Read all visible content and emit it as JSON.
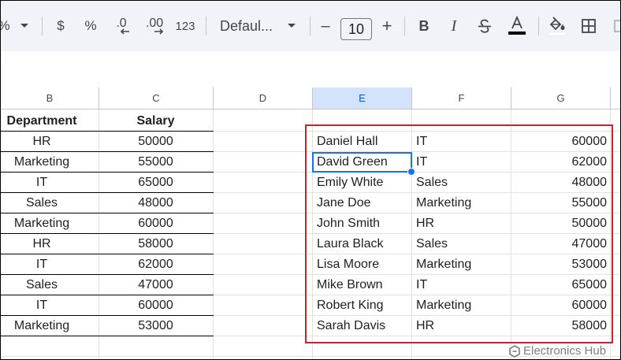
{
  "toolbar": {
    "percent_partial": "%",
    "currency": "$",
    "percent": "%",
    "decrease_decimal": ".0",
    "increase_decimal": ".00",
    "number_format": "123",
    "font_name": "Defaul...",
    "font_size": "10",
    "minus": "–",
    "plus": "+",
    "bold": "B",
    "italic": "I"
  },
  "columns": [
    {
      "id": "B",
      "label": "B"
    },
    {
      "id": "C",
      "label": "C"
    },
    {
      "id": "D",
      "label": "D"
    },
    {
      "id": "E",
      "label": "E"
    },
    {
      "id": "F",
      "label": "F"
    },
    {
      "id": "G",
      "label": "G"
    }
  ],
  "left_table": {
    "headers": {
      "department": "Department",
      "salary": "Salary"
    },
    "rows": [
      {
        "department": "HR",
        "salary": "50000"
      },
      {
        "department": "Marketing",
        "salary": "55000"
      },
      {
        "department": "IT",
        "salary": "65000"
      },
      {
        "department": "Sales",
        "salary": "48000"
      },
      {
        "department": "Marketing",
        "salary": "60000"
      },
      {
        "department": "HR",
        "salary": "58000"
      },
      {
        "department": "IT",
        "salary": "62000"
      },
      {
        "department": "Sales",
        "salary": "47000"
      },
      {
        "department": "IT",
        "salary": "60000"
      },
      {
        "department": "Marketing",
        "salary": "53000"
      }
    ]
  },
  "right_table": {
    "rows": [
      {
        "name": "Daniel Hall",
        "department": "IT",
        "salary": "60000"
      },
      {
        "name": "David Green",
        "department": "IT",
        "salary": "62000"
      },
      {
        "name": "Emily White",
        "department": "Sales",
        "salary": "48000"
      },
      {
        "name": "Jane Doe",
        "department": "Marketing",
        "salary": "55000"
      },
      {
        "name": "John Smith",
        "department": "HR",
        "salary": "50000"
      },
      {
        "name": "Laura Black",
        "department": "Sales",
        "salary": "47000"
      },
      {
        "name": "Lisa Moore",
        "department": "Marketing",
        "salary": "53000"
      },
      {
        "name": "Mike Brown",
        "department": "IT",
        "salary": "65000"
      },
      {
        "name": "Robert King",
        "department": "Marketing",
        "salary": "60000"
      },
      {
        "name": "Sarah Davis",
        "department": "HR",
        "salary": "58000"
      }
    ]
  },
  "watermark": "Electronics Hub",
  "colors": {
    "accent": "#1a73e8",
    "highlight_border": "#c0282d",
    "toolbar_bg": "#f0f4f9",
    "active_header": "#d3e3fd"
  }
}
